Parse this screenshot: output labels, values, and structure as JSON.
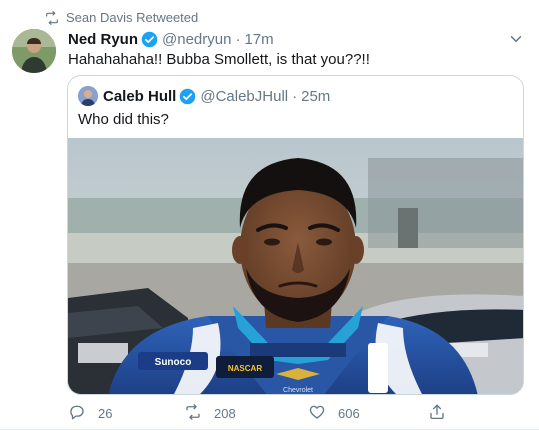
{
  "retweet_context": {
    "text": "Sean Davis Retweeted",
    "icon": "retweet-icon"
  },
  "author": {
    "name": "Ned Ryun",
    "handle": "@nedryun",
    "separator": "·",
    "time": "17m",
    "verified": true
  },
  "text": "Hahahahaha!! Bubba Smollett, is that you??!!",
  "quoted": {
    "author": {
      "name": "Caleb Hull",
      "handle": "@CalebJHull",
      "separator": "·",
      "time": "25m",
      "verified": true
    },
    "text": "Who did this?",
    "media_description": "Photo of a man in a blue NASCAR racing suit with a race car and pit area in the background",
    "suit_logos": [
      "Sunoco",
      "NASCAR",
      "Chevrolet"
    ]
  },
  "actions": {
    "reply": {
      "icon": "reply-icon",
      "count": "26"
    },
    "retweet": {
      "icon": "retweet-icon",
      "count": "208"
    },
    "like": {
      "icon": "heart-icon",
      "count": "606"
    },
    "share": {
      "icon": "share-icon"
    }
  },
  "colors": {
    "accent": "#1da1f2",
    "secondary_text": "#657786",
    "border": "#ccd6dd"
  }
}
